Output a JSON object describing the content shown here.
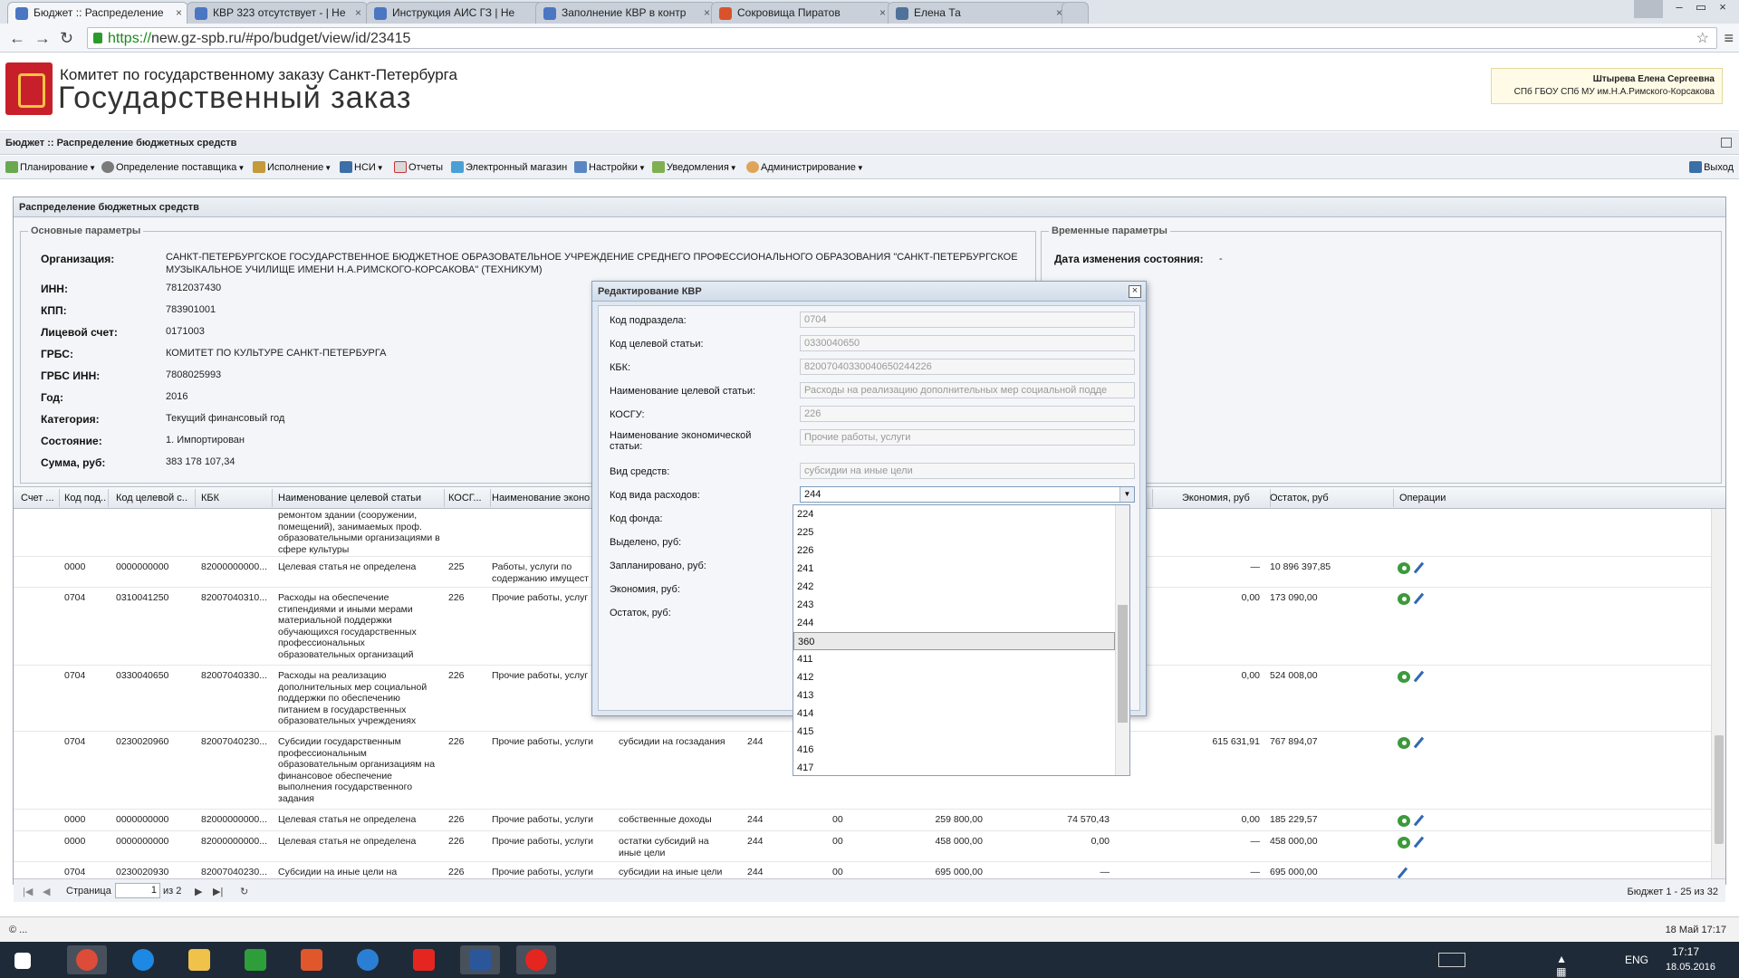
{
  "browser": {
    "tabs": [
      {
        "title": "Бюджет :: Распределение"
      },
      {
        "title": "КВР 323 отсутствует - | Не"
      },
      {
        "title": "Инструкция АИС ГЗ | Не"
      },
      {
        "title": "Заполнение КВР в контр"
      },
      {
        "title": "Сокровища Пиратов"
      },
      {
        "title": "Елена Та"
      }
    ],
    "url_scheme": "https://",
    "url_rest": "new.gz-spb.ru/#po/budget/view/id/23415"
  },
  "header": {
    "org_small": "Комитет по государственному заказу Санкт-Петербурга",
    "org_big": "Государственный заказ",
    "user_name": "Штырева Елена Сергеевна",
    "user_org": "СПб ГБОУ СПб МУ им.Н.А.Римского-Корсакова"
  },
  "breadcrumb": "Бюджет :: Распределение бюджетных средств",
  "menu": {
    "planning": "Планирование",
    "supplier": "Определение поставщика",
    "execution": "Исполнение",
    "nsi": "НСИ",
    "reports": "Отчеты",
    "eshop": "Электронный магазин",
    "settings": "Настройки",
    "notifications": "Уведомления",
    "admin": "Администрирование",
    "exit": "Выход"
  },
  "panel": {
    "title": "Распределение бюджетных средств",
    "main_legend": "Основные параметры",
    "temp_legend": "Временные параметры",
    "fields": {
      "org_label": "Организация:",
      "org_value": "САНКТ-ПЕТЕРБУРГСКОЕ ГОСУДАРСТВЕННОЕ БЮДЖЕТНОЕ ОБРАЗОВАТЕЛЬНОЕ УЧРЕЖДЕНИЕ СРЕДНЕГО ПРОФЕССИОНАЛЬНОГО ОБРАЗОВАНИЯ \"САНКТ-ПЕТЕРБУРГСКОЕ МУЗЫКАЛЬНОЕ УЧИЛИЩЕ ИМЕНИ Н.А.РИМСКОГО-КОРСАКОВА\" (ТЕХНИКУМ)",
      "inn_label": "ИНН:",
      "inn_value": "7812037430",
      "kpp_label": "КПП:",
      "kpp_value": "783901001",
      "account_label": "Лицевой счет:",
      "account_value": "0171003",
      "grbs_label": "ГРБС:",
      "grbs_value": "КОМИТЕТ ПО КУЛЬТУРЕ САНКТ-ПЕТЕРБУРГА",
      "grbs_inn_label": "ГРБС ИНН:",
      "grbs_inn_value": "7808025993",
      "year_label": "Год:",
      "year_value": "2016",
      "category_label": "Категория:",
      "category_value": "Текущий финансовый год",
      "state_label": "Состояние:",
      "state_value": "1. Импортирован",
      "sum_label": "Сумма, руб:",
      "sum_value": "383 178 107,34",
      "state_change_label": "Дата изменения состояния:",
      "state_change_value": "-"
    }
  },
  "grid": {
    "headers": [
      "Счет ...",
      "Код под...",
      "Код целевой с...",
      "КБК",
      "Наименование целевой статьи",
      "КОСГ...",
      "Наименование эконо",
      "Экономия, руб",
      "Остаток, руб",
      "Операции"
    ],
    "rows": [
      {
        "c0": "",
        "c1": "",
        "c2": "",
        "c3": "",
        "c4": "ремонтом здании (сооружении, помещений), занимаемых проф. образовательными организациями в сфере культуры",
        "c5": "",
        "c6": "",
        "c7": "",
        "c8": "",
        "c9": "",
        "c10": "",
        "c11": "",
        "c12": "",
        "c13": ""
      },
      {
        "c0": "",
        "c1": "0000",
        "c2": "0000000000",
        "c3": "82000000000...",
        "c4": "Целевая статья не определена",
        "c5": "225",
        "c6": "Работы, услуги по содержанию имущест",
        "c7": "",
        "c8": "",
        "c9": "",
        "c10": "",
        "c11": "",
        "c12": "—",
        "c13": "10 896 397,85"
      },
      {
        "c0": "",
        "c1": "0704",
        "c2": "0310041250",
        "c3": "82007040310...",
        "c4": "Расходы на обеспечение стипендиями и иными мерами материальной поддержки обучающихся государственных профессиональных образовательных организаций",
        "c5": "226",
        "c6": "Прочие работы, услуг",
        "c7": "",
        "c8": "",
        "c9": "",
        "c10": "",
        "c11": "",
        "c12": "0,00",
        "c13": "173 090,00"
      },
      {
        "c0": "",
        "c1": "0704",
        "c2": "0330040650",
        "c3": "82007040330...",
        "c4": "Расходы на реализацию дополнительных мер социальной поддержки по обеспечению питанием в государственных образовательных учреждениях",
        "c5": "226",
        "c6": "Прочие работы, услуг",
        "c7": "",
        "c8": "",
        "c9": "",
        "c10": "",
        "c11": "",
        "c12": "0,00",
        "c13": "524 008,00"
      },
      {
        "c0": "",
        "c1": "0704",
        "c2": "0230020960",
        "c3": "82007040230...",
        "c4": "Субсидии государственным профессиональным образовательным организациям на финансовое обеспечение выполнения государственного задания",
        "c5": "226",
        "c6": "Прочие работы, услуги",
        "c7": "субсидии на госзадания",
        "c8": "244",
        "c9": "",
        "c10": "",
        "c11": "",
        "c12": "615 631,91",
        "c13": "767 894,07"
      },
      {
        "c0": "",
        "c1": "0000",
        "c2": "0000000000",
        "c3": "82000000000...",
        "c4": "Целевая статья не определена",
        "c5": "226",
        "c6": "Прочие работы, услуги",
        "c7": "собственные доходы",
        "c8": "244",
        "c9": "00",
        "c10": "259 800,00",
        "c11": "74 570,43",
        "c12": "0,00",
        "c13": "185 229,57"
      },
      {
        "c0": "",
        "c1": "0000",
        "c2": "0000000000",
        "c3": "82000000000...",
        "c4": "Целевая статья не определена",
        "c5": "226",
        "c6": "Прочие работы, услуги",
        "c7": "остатки субсидий на иные цели",
        "c8": "244",
        "c9": "00",
        "c10": "458 000,00",
        "c11": "0,00",
        "c12": "—",
        "c13": "458 000,00"
      },
      {
        "c0": "",
        "c1": "0704",
        "c2": "0230020930",
        "c3": "82007040230...",
        "c4": "Субсидии на иные цели на",
        "c5": "226",
        "c6": "Прочие работы, услуги",
        "c7": "субсидии на иные цели",
        "c8": "244",
        "c9": "00",
        "c10": "695 000,00",
        "c11": "—",
        "c12": "—",
        "c13": "695 000,00"
      }
    ],
    "pager": {
      "label": "Страница",
      "page": "1",
      "of": "из 2",
      "summary": "Бюджет 1 - 25 из 32"
    }
  },
  "dialog": {
    "title": "Редактирование КВР",
    "fields": [
      {
        "label": "Код подраздела:",
        "value": "0704"
      },
      {
        "label": "Код целевой статьи:",
        "value": "0330040650"
      },
      {
        "label": "КБК:",
        "value": "82007040330040650244226"
      },
      {
        "label": "Наименование целевой статьи:",
        "value": "Расходы на реализацию дополнительных мер социальной подде"
      },
      {
        "label": "КОСГУ:",
        "value": "226"
      },
      {
        "label": "Наименование экономической статьи:",
        "value": "Прочие работы, услуги"
      },
      {
        "label": "Вид средств:",
        "value": "субсидии на иные цели"
      },
      {
        "label": "Код вида расходов:",
        "value": "244"
      },
      {
        "label": "Код фонда:",
        "value": ""
      },
      {
        "label": "Выделено, руб:",
        "value": ""
      },
      {
        "label": "Запланировано, руб:",
        "value": ""
      },
      {
        "label": "Экономия, руб:",
        "value": ""
      },
      {
        "label": "Остаток, руб:",
        "value": ""
      }
    ],
    "dropdown_options": [
      "224",
      "225",
      "226",
      "241",
      "242",
      "243",
      "244",
      "360",
      "411",
      "412",
      "413",
      "414",
      "415",
      "416",
      "417"
    ],
    "dropdown_highlighted": "360"
  },
  "statusbar": {
    "left": "© ...",
    "right": "18 Май 17:17"
  },
  "taskbar": {
    "time": "17:17",
    "date": "18.05.2016",
    "lang": "ENG"
  },
  "colors": {
    "accent": "#3c6ea8",
    "logo_red": "#c8202b",
    "taskbar": "#1f2a38"
  }
}
